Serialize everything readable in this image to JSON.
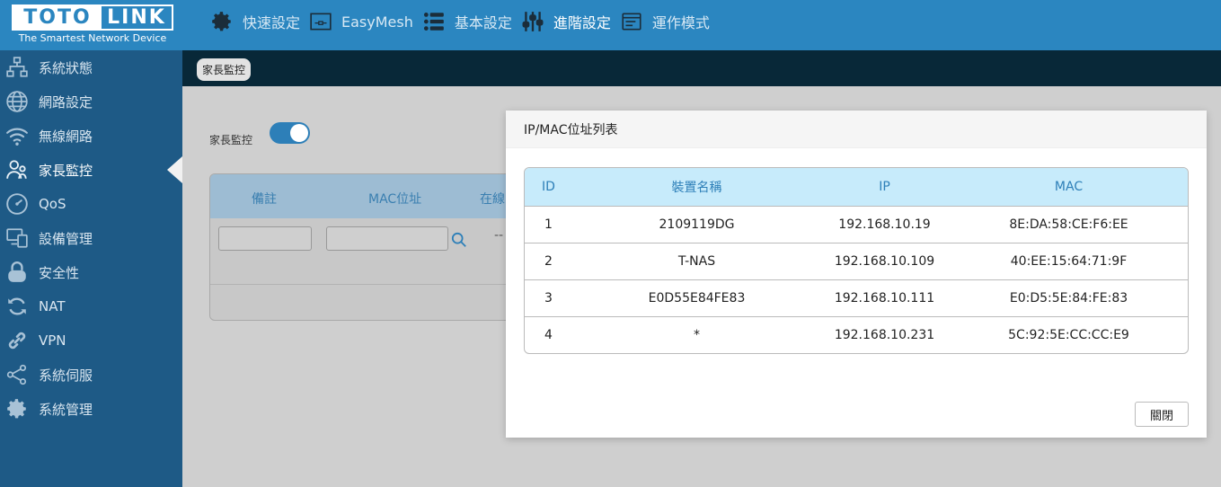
{
  "brand": {
    "logo_left": "TOTO",
    "logo_right": "LINK",
    "tagline": "The Smartest Network Device"
  },
  "top_nav": [
    {
      "label": "快速設定",
      "icon": "gear-icon"
    },
    {
      "label": "EasyMesh",
      "icon": "mesh-icon"
    },
    {
      "label": "基本設定",
      "icon": "list-icon"
    },
    {
      "label": "進階設定",
      "icon": "sliders-icon",
      "active": true
    },
    {
      "label": "運作模式",
      "icon": "mode-icon"
    }
  ],
  "sidebar": [
    {
      "label": "系統狀態",
      "icon": "network-status-icon"
    },
    {
      "label": "網路設定",
      "icon": "globe-icon"
    },
    {
      "label": "無線網路",
      "icon": "wifi-icon"
    },
    {
      "label": "家長監控",
      "icon": "parental-control-icon",
      "active": true
    },
    {
      "label": "QoS",
      "icon": "speedometer-icon"
    },
    {
      "label": "設備管理",
      "icon": "devices-icon"
    },
    {
      "label": "安全性",
      "icon": "lock-icon"
    },
    {
      "label": "NAT",
      "icon": "refresh-icon"
    },
    {
      "label": "VPN",
      "icon": "link-icon"
    },
    {
      "label": "系統伺服",
      "icon": "share-icon"
    },
    {
      "label": "系統管理",
      "icon": "settings-icon"
    }
  ],
  "breadcrumb": "家長監控",
  "parental_control": {
    "toggle_label": "家長監控",
    "enabled": true,
    "columns": [
      "備註",
      "MAC位址",
      "在線"
    ],
    "row_dash": "--"
  },
  "modal": {
    "title": "IP/MAC位址列表",
    "columns": [
      "ID",
      "裝置名稱",
      "IP",
      "MAC"
    ],
    "rows": [
      [
        "1",
        "2109119DG",
        "192.168.10.19",
        "8E:DA:58:CE:F6:EE"
      ],
      [
        "2",
        "T-NAS",
        "192.168.10.109",
        "40:EE:15:64:71:9F"
      ],
      [
        "3",
        "E0D55E84FE83",
        "192.168.10.111",
        "E0:D5:5E:84:FE:83"
      ],
      [
        "4",
        "*",
        "192.168.10.231",
        "5C:92:5E:CC:CC:E9"
      ]
    ],
    "close_label": "關閉"
  },
  "colors": {
    "header_blue": "#2b86c0",
    "sidebar_blue": "#1e5a86",
    "table_head": "#c7ebfb",
    "accent": "#2d7fb8"
  }
}
